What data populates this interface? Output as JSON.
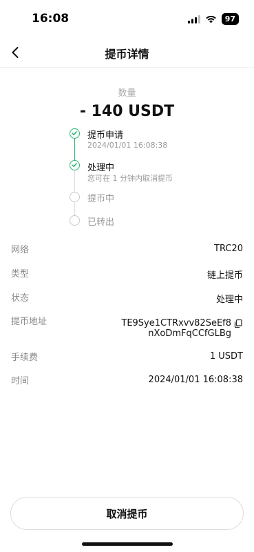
{
  "status_bar": {
    "time": "16:08",
    "battery": "97"
  },
  "header": {
    "title": "提币详情"
  },
  "amount": {
    "label": "数量",
    "value": "- 140 USDT"
  },
  "timeline": [
    {
      "title": "提币申请",
      "subtitle": "2024/01/01 16:08:38",
      "state": "done"
    },
    {
      "title": "处理中",
      "subtitle": "您可在 1 分钟内取消提币",
      "state": "done"
    },
    {
      "title": "提币中",
      "subtitle": "",
      "state": "pending"
    },
    {
      "title": "已转出",
      "subtitle": "",
      "state": "pending"
    }
  ],
  "details": {
    "network_label": "网络",
    "network_value": "TRC20",
    "type_label": "类型",
    "type_value": "链上提币",
    "status_label": "状态",
    "status_value": "处理中",
    "address_label": "提币地址",
    "address_line1": "TE9Sye1CTRxvv82SeEf8",
    "address_line2": "nXoDmFqCCfGLBg",
    "fee_label": "手续费",
    "fee_value": "1 USDT",
    "time_label": "时间",
    "time_value": "2024/01/01 16:08:38"
  },
  "cancel_button": {
    "label": "取消提币"
  },
  "colors": {
    "accent_green": "#2bb673",
    "pending_gray": "#c8c8c8",
    "label_gray": "#8a8a8a"
  },
  "icons": {
    "back": "chevron-left-icon",
    "copy": "copy-icon",
    "check": "check-icon"
  }
}
